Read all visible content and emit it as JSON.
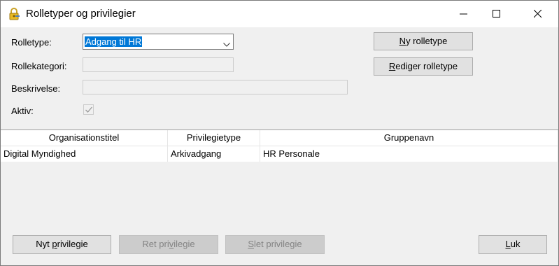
{
  "window": {
    "title": "Rolletyper og privilegier",
    "icon": "key-lock-icon"
  },
  "form": {
    "rolletype_label": "Rolletype:",
    "rolletype_value": "Adgang til HR",
    "rollekategori_label": "Rollekategori:",
    "rollekategori_value": "",
    "beskrivelse_label": "Beskrivelse:",
    "beskrivelse_value": "",
    "aktiv_label": "Aktiv:",
    "aktiv_checked": true
  },
  "buttons": {
    "ny_rolletype": {
      "mnemonic": "N",
      "rest": "y rolletype"
    },
    "rediger_rolletype": {
      "mnemonic": "R",
      "rest": "ediger rolletype"
    },
    "nyt_privilegie": {
      "pre": "Nyt ",
      "mnemonic": "p",
      "rest": "rivilegie"
    },
    "ret_privilegie": {
      "pre": "Ret pri",
      "mnemonic": "v",
      "rest": "ilegie",
      "disabled": true
    },
    "slet_privilegie": {
      "pre": "",
      "mnemonic": "S",
      "rest": "let privilegie",
      "disabled": true
    },
    "luk": {
      "mnemonic": "L",
      "rest": "uk"
    }
  },
  "table": {
    "columns": [
      "Organisationstitel",
      "Privilegietype",
      "Gruppenavn"
    ],
    "rows": [
      [
        "Digital Myndighed",
        "Arkivadgang",
        "HR Personale"
      ]
    ]
  },
  "colors": {
    "selection": "#0078d7",
    "window_bg": "#f0f0f0"
  }
}
